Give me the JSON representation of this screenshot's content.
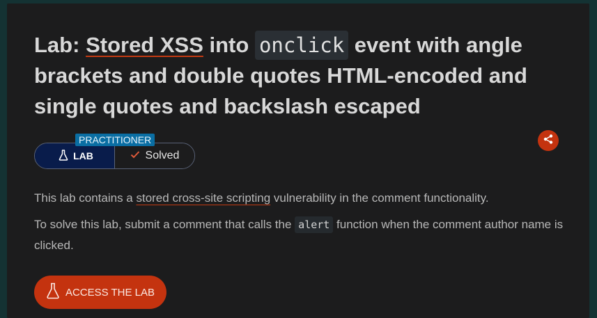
{
  "title": {
    "prefix": "Lab: ",
    "link": "Stored XSS",
    "middle": " into ",
    "code": "onclick",
    "suffix": " event with angle brackets and double quotes HTML-encoded and single quotes and backslash escaped"
  },
  "badge": {
    "level": "PRACTITIONER",
    "lab_label": "LAB",
    "status": "Solved"
  },
  "description": {
    "p1_before": "This lab contains a ",
    "p1_link": "stored cross-site scripting",
    "p1_after": " vulnerability in the comment functionality.",
    "p2_before": "To solve this lab, submit a comment that calls the ",
    "p2_code": "alert",
    "p2_after": " function when the comment author name is clicked."
  },
  "access_button": {
    "label": "ACCESS THE LAB"
  },
  "icons": {
    "flask": "flask-icon",
    "check": "check-icon",
    "share": "share-icon"
  },
  "colors": {
    "accent": "#c4330f",
    "lab_badge_bg": "#091c4b",
    "level_tag_bg": "#0a6ea3",
    "panel_bg": "#1c1c1d",
    "page_bg": "#143233"
  }
}
